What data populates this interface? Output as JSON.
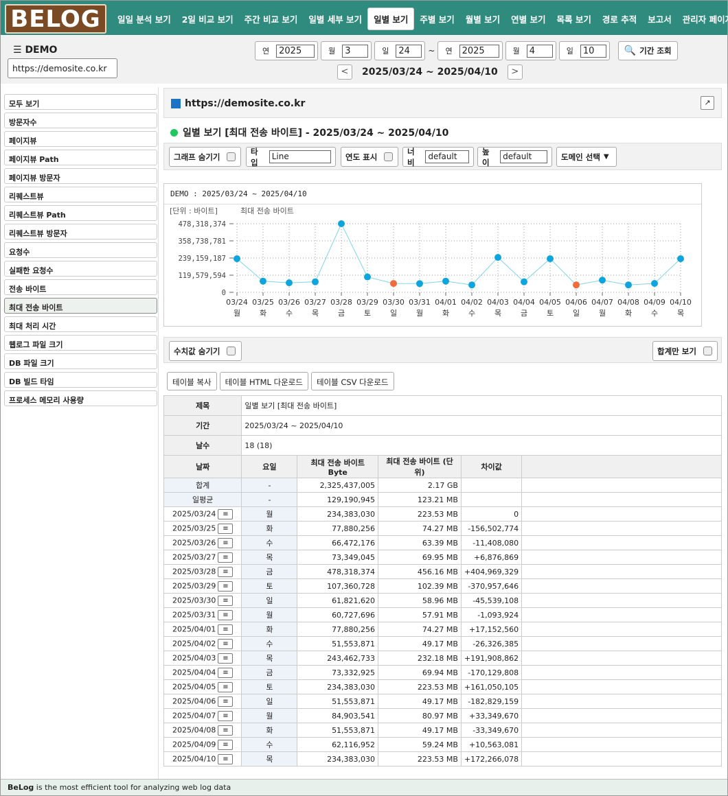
{
  "logo_text": "BELOG",
  "nav": [
    "일일 분석 보기",
    "2일 비교 보기",
    "주간 비교 보기",
    "일별 세부 보기",
    "일별 보기",
    "주별 보기",
    "월별 보기",
    "연별 보기",
    "목록 보기",
    "경로 추적",
    "보고서",
    "관리자 페이지"
  ],
  "nav_active": 4,
  "header": {
    "menu_icon": "hamburger-icon",
    "title": "DEMO",
    "site": "https://demosite.co.kr",
    "start": {
      "year_label": "연",
      "year": "2025",
      "month_label": "월",
      "month": "3",
      "day_label": "일",
      "day": "24"
    },
    "tilde": "~",
    "end": {
      "year_label": "연",
      "year": "2025",
      "month_label": "월",
      "month": "4",
      "day_label": "일",
      "day": "10"
    },
    "search_label": "기간 조회",
    "prev": "<",
    "next": ">",
    "range": "2025/03/24 ~ 2025/04/10"
  },
  "sidebar": [
    "모두 보기",
    "방문자수",
    "페이지뷰",
    "페이지뷰 Path",
    "페이지뷰 방문자",
    "리퀘스트뷰",
    "리퀘스트뷰 Path",
    "리퀘스트뷰 방문자",
    "요청수",
    "실패한 요청수",
    "전송 바이트",
    "최대 전송 바이트",
    "최대 처리 시간",
    "웹로그 파일 크기",
    "DB 파일 크기",
    "DB 빌드 타임",
    "프로세스 메모리 사용량"
  ],
  "sidebar_active": 11,
  "main": {
    "site_title": "https://demosite.co.kr",
    "ext_icon": "↗",
    "report_title": "일별 보기 [최대 전송 바이트] - 2025/03/24 ~ 2025/04/10",
    "toolbar": {
      "hide_graph": "그래프 숨기기",
      "type_label": "타입",
      "type_value": "Line",
      "show_year": "연도 표시",
      "width_label": "너비",
      "width_value": "default",
      "height_label": "높이",
      "height_value": "default",
      "domain_select": "도메인 선택",
      "domain_arrow": "▼"
    },
    "hide_values": "수치값 숨기기",
    "sum_only": "합계만 보기",
    "copy_table": "테이블 복사",
    "html_download": "테이블 HTML 다운로드",
    "csv_download": "테이블 CSV 다운로드"
  },
  "chart_data": {
    "type": "line",
    "title": "DEMO : 2025/03/24 ~ 2025/04/10",
    "unit_label": "[단위 : 바이트]",
    "series": [
      {
        "name": "최대 전송 바이트",
        "values": [
          234383030,
          77880256,
          66472176,
          73349045,
          478318374,
          107360728,
          61821620,
          60727696,
          77880256,
          51553871,
          243462733,
          73332925,
          234383030,
          51553871,
          84903541,
          51553871,
          62116952,
          234383030
        ]
      }
    ],
    "categories": [
      "03/24",
      "03/25",
      "03/26",
      "03/27",
      "03/28",
      "03/29",
      "03/30",
      "03/31",
      "04/01",
      "04/02",
      "04/03",
      "04/04",
      "04/05",
      "04/06",
      "04/07",
      "04/08",
      "04/09",
      "04/10"
    ],
    "weekdays": [
      "월",
      "화",
      "수",
      "목",
      "금",
      "토",
      "일",
      "월",
      "화",
      "수",
      "목",
      "금",
      "토",
      "일",
      "월",
      "화",
      "수",
      "목"
    ],
    "sunday_indices": [
      6,
      13
    ],
    "yticks": [
      "478,318,374",
      "358,738,781",
      "239,159,187",
      "119,579,594",
      "0"
    ],
    "ytick_values": [
      478318374,
      358738781,
      239159187,
      119579594,
      0
    ],
    "ylim": [
      0,
      478318374
    ],
    "line_color": "#7fd3ef",
    "point_color": "#0ea5de",
    "sunday_color": "#f26b3a",
    "grid": true
  },
  "table": {
    "meta": [
      {
        "label": "제목",
        "value": "일별 보기 [최대 전송 바이트]"
      },
      {
        "label": "기간",
        "value": "2025/03/24 ~ 2025/04/10"
      },
      {
        "label": "날수",
        "value": "18 (18)"
      }
    ],
    "headers": [
      "날짜",
      "요일",
      "최대 전송 바이트 Byte",
      "최대 전송 바이트 (단위)",
      "차이값"
    ],
    "summary": [
      {
        "date": "합계",
        "dow": "-",
        "bytes": "2,325,437,005",
        "unit": "2.17 GB",
        "diff": ""
      },
      {
        "date": "일평균",
        "dow": "-",
        "bytes": "129,190,945",
        "unit": "123.21 MB",
        "diff": ""
      }
    ],
    "rows": [
      {
        "date": "2025/03/24",
        "dow": "월",
        "bytes": "234,383,030",
        "unit": "223.53 MB",
        "diff": "0"
      },
      {
        "date": "2025/03/25",
        "dow": "화",
        "bytes": "77,880,256",
        "unit": "74.27 MB",
        "diff": "-156,502,774"
      },
      {
        "date": "2025/03/26",
        "dow": "수",
        "bytes": "66,472,176",
        "unit": "63.39 MB",
        "diff": "-11,408,080"
      },
      {
        "date": "2025/03/27",
        "dow": "목",
        "bytes": "73,349,045",
        "unit": "69.95 MB",
        "diff": "+6,876,869"
      },
      {
        "date": "2025/03/28",
        "dow": "금",
        "bytes": "478,318,374",
        "unit": "456.16 MB",
        "diff": "+404,969,329"
      },
      {
        "date": "2025/03/29",
        "dow": "토",
        "bytes": "107,360,728",
        "unit": "102.39 MB",
        "diff": "-370,957,646"
      },
      {
        "date": "2025/03/30",
        "dow": "일",
        "bytes": "61,821,620",
        "unit": "58.96 MB",
        "diff": "-45,539,108"
      },
      {
        "date": "2025/03/31",
        "dow": "월",
        "bytes": "60,727,696",
        "unit": "57.91 MB",
        "diff": "-1,093,924"
      },
      {
        "date": "2025/04/01",
        "dow": "화",
        "bytes": "77,880,256",
        "unit": "74.27 MB",
        "diff": "+17,152,560"
      },
      {
        "date": "2025/04/02",
        "dow": "수",
        "bytes": "51,553,871",
        "unit": "49.17 MB",
        "diff": "-26,326,385"
      },
      {
        "date": "2025/04/03",
        "dow": "목",
        "bytes": "243,462,733",
        "unit": "232.18 MB",
        "diff": "+191,908,862"
      },
      {
        "date": "2025/04/04",
        "dow": "금",
        "bytes": "73,332,925",
        "unit": "69.94 MB",
        "diff": "-170,129,808"
      },
      {
        "date": "2025/04/05",
        "dow": "토",
        "bytes": "234,383,030",
        "unit": "223.53 MB",
        "diff": "+161,050,105"
      },
      {
        "date": "2025/04/06",
        "dow": "일",
        "bytes": "51,553,871",
        "unit": "49.17 MB",
        "diff": "-182,829,159"
      },
      {
        "date": "2025/04/07",
        "dow": "월",
        "bytes": "84,903,541",
        "unit": "80.97 MB",
        "diff": "+33,349,670"
      },
      {
        "date": "2025/04/08",
        "dow": "화",
        "bytes": "51,553,871",
        "unit": "49.17 MB",
        "diff": "-33,349,670"
      },
      {
        "date": "2025/04/09",
        "dow": "수",
        "bytes": "62,116,952",
        "unit": "59.24 MB",
        "diff": "+10,563,081"
      },
      {
        "date": "2025/04/10",
        "dow": "목",
        "bytes": "234,383,030",
        "unit": "223.53 MB",
        "diff": "+172,266,078"
      }
    ],
    "row_icon": "≡"
  },
  "footer": {
    "brand": "BeLog",
    "text": " is the most efficient tool for analyzing web log data"
  }
}
